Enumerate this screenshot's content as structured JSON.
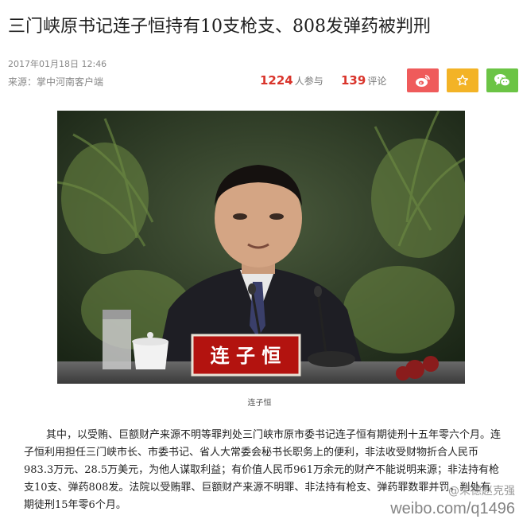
{
  "article": {
    "headline": "三门峡原书记连子恒持有10支枪支、808发弹药被判刑",
    "date": "2017年01月18日  12:46",
    "source": "来源：掌中河南客户端",
    "participants_count": "1224",
    "participants_label": "人参与",
    "comments_count": "139",
    "comments_label": "评论",
    "photo_caption": "连子恒",
    "nameplate_text": "连 子 恒",
    "body": "其中，以受贿、巨额财产来源不明等罪判处三门峡市原市委书记连子恒有期徒刑十五年零六个月。连子恒利用担任三门峡市长、市委书记、省人大常委会秘书长职务上的便利，非法收受财物折合人民币983.3万元、28.5万美元，为他人谋取利益；有价值人民币961万余元的财产不能说明来源；非法持有枪支10支、弹药808发。法院以受贿罪、巨额财产来源不明罪、非法持有枪支、弹药罪数罪并罚，判处有期徒刑15年零6个月。"
  },
  "share": {
    "weibo_icon": "weibo-icon",
    "favorite_icon": "star-icon",
    "wechat_icon": "wechat-icon",
    "colors": {
      "weibo": "#ef5b5b",
      "favorite": "#f3b326",
      "wechat": "#6bc445",
      "accent": "#d9342b"
    }
  },
  "watermark": {
    "handle": "@荣德赵克强",
    "url": "weibo.com/q1496"
  }
}
